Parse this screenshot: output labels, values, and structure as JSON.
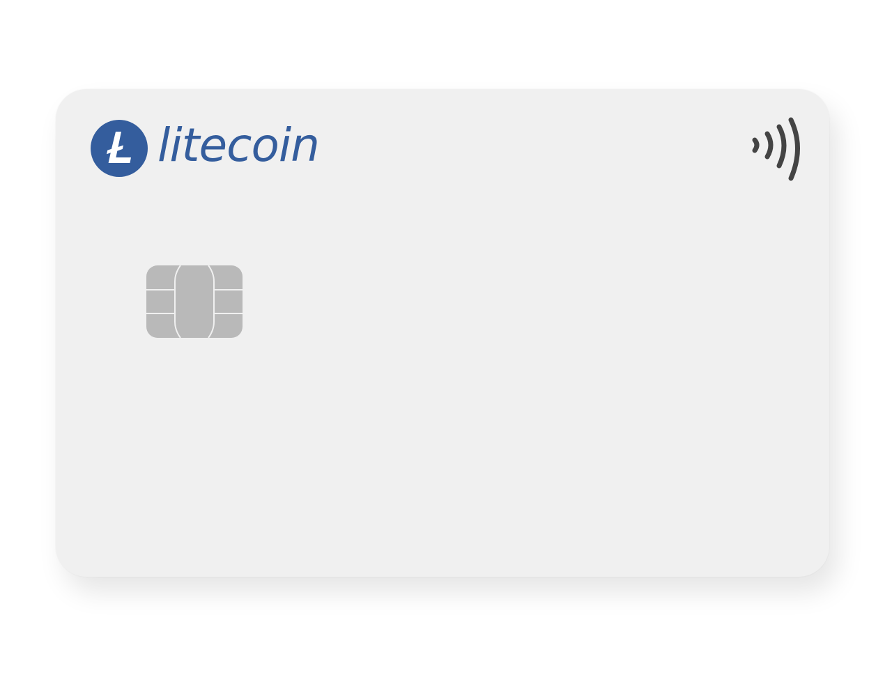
{
  "card": {
    "brand": {
      "name": "litecoin",
      "logo_icon": "litecoin-logo-icon",
      "logo_color": "#345d9d"
    },
    "icons": {
      "contactless": "contactless-icon",
      "chip": "emv-chip-icon"
    },
    "colors": {
      "card_background": "#f0f0f0",
      "chip": "#b9b9b9",
      "contactless": "#444444"
    }
  }
}
